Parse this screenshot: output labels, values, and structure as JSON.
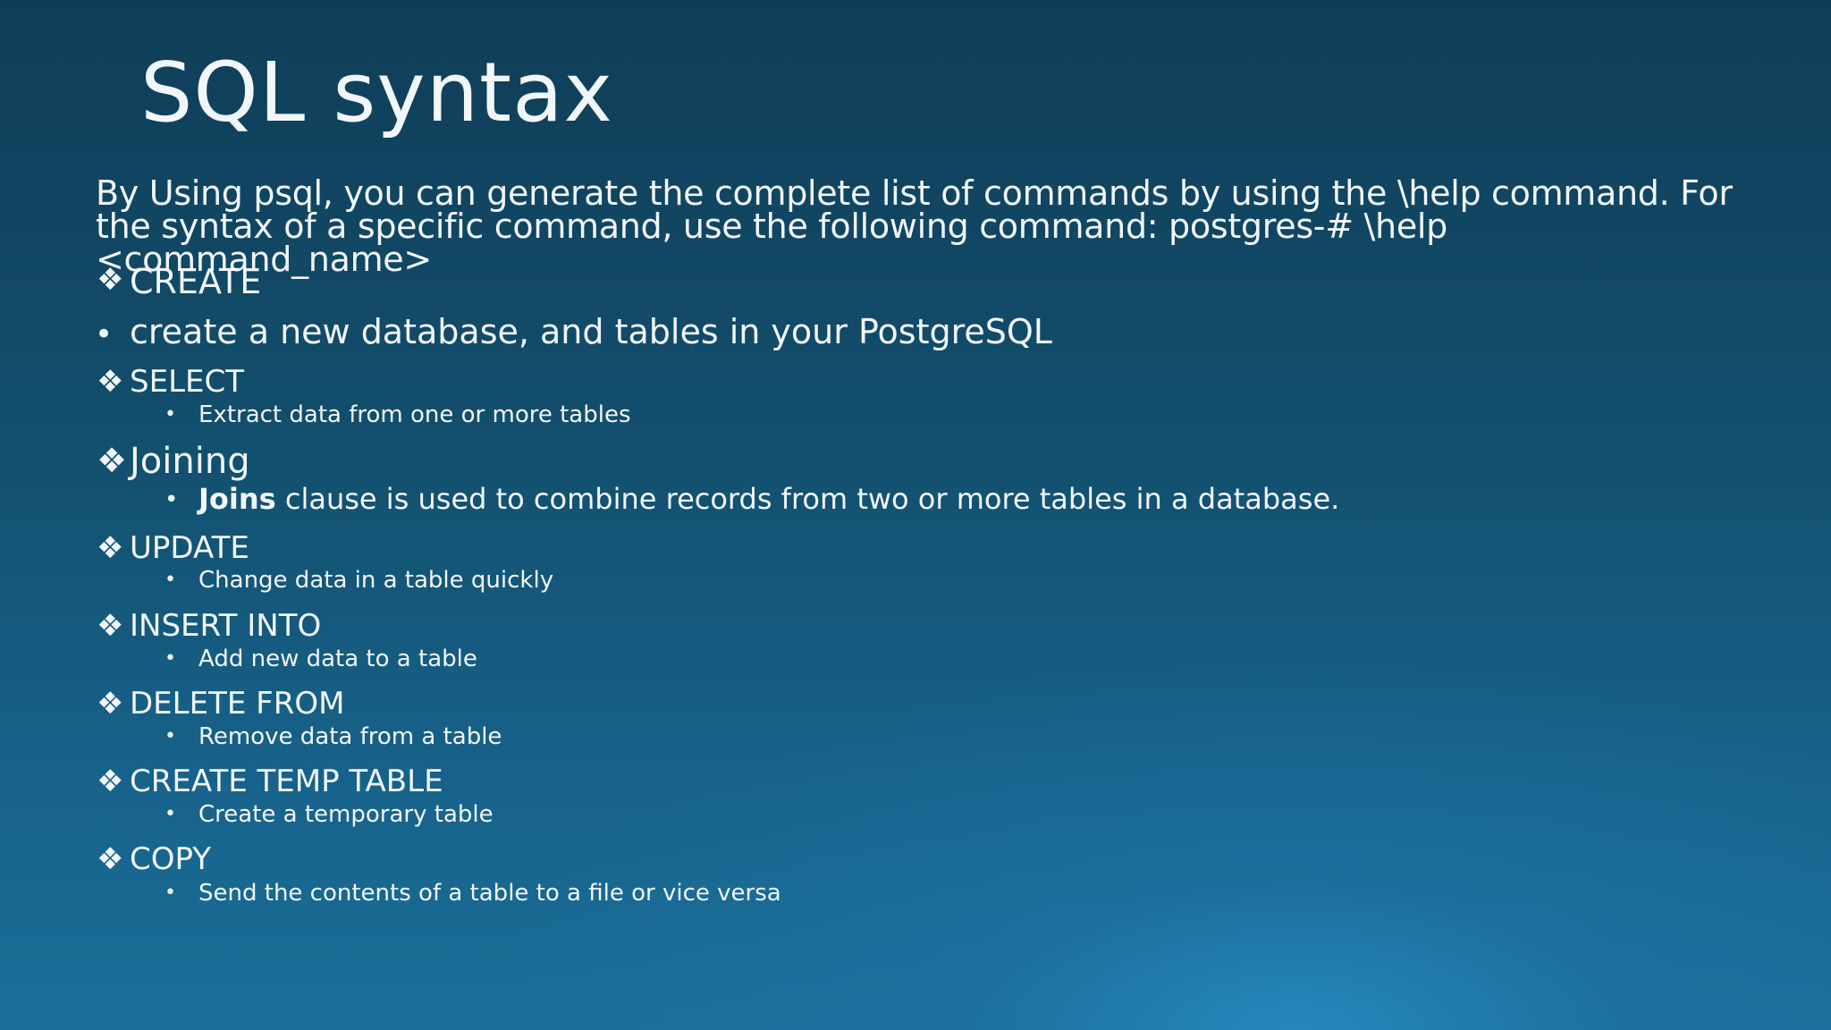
{
  "slide": {
    "title": "SQL syntax",
    "intro": "By Using psql, you can generate the complete list of commands by using the \\help command. For the syntax of a specific command, use the following command: postgres-# \\help <command_name>",
    "create": {
      "heading": "CREATE",
      "description": "create a new database, and tables  in your PostgreSQL"
    },
    "select": {
      "heading": "SELECT",
      "description": "Extract data from one or more tables"
    },
    "joining": {
      "heading": "Joining",
      "description_bold": "Joins",
      "description_rest": " clause is used to combine records from two or more tables in a database."
    },
    "update": {
      "heading": "UPDATE",
      "description": "Change data in a table quickly"
    },
    "insert": {
      "heading": "INSERT INTO",
      "description": "Add new data to a table"
    },
    "delete": {
      "heading": "DELETE FROM",
      "description": "Remove data from a table"
    },
    "temp": {
      "heading": "CREATE TEMP TABLE",
      "description": "Create a temporary table"
    },
    "copy": {
      "heading": "COPY",
      "description": "Send the contents of a table to a file or vice versa"
    }
  },
  "glyphs": {
    "diamond": "❖",
    "bullet": "•"
  },
  "colors": {
    "text": "#f1f6f9",
    "background_top": "#0f3d57",
    "background_bottom": "#1a6f99"
  }
}
